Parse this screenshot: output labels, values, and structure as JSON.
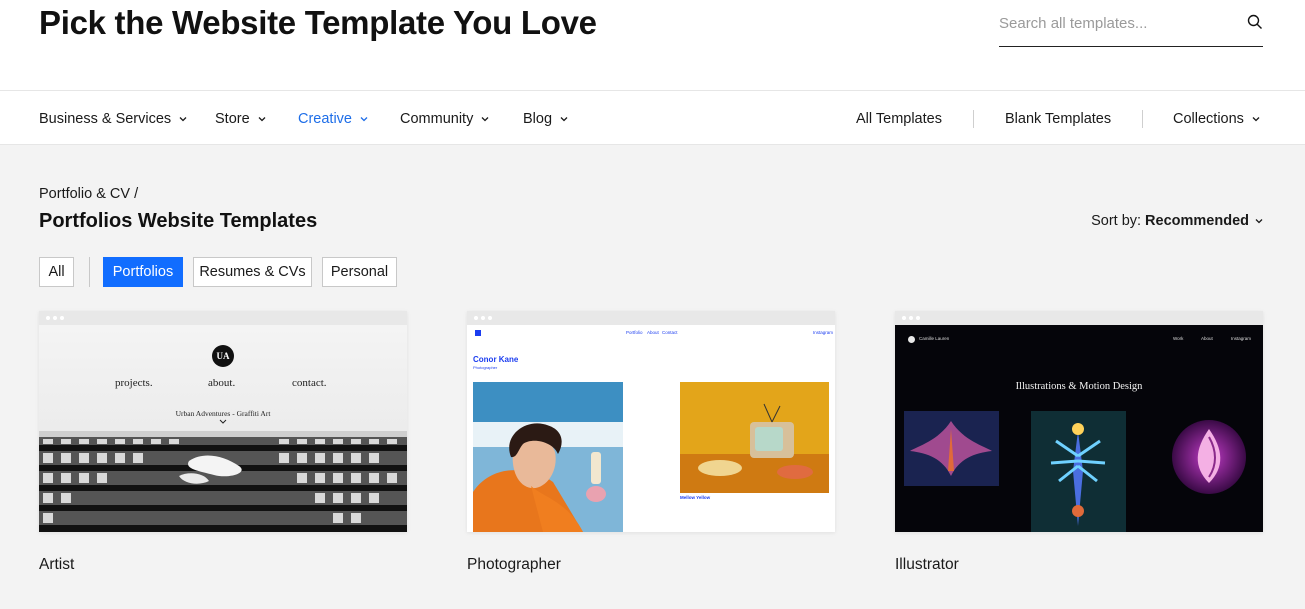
{
  "header": {
    "title": "Pick the Website Template You Love",
    "search_placeholder": "Search all templates..."
  },
  "nav": {
    "items": [
      {
        "label": "Business & Services",
        "active": false
      },
      {
        "label": "Store",
        "active": false
      },
      {
        "label": "Creative",
        "active": true
      },
      {
        "label": "Community",
        "active": false
      },
      {
        "label": "Blog",
        "active": false
      }
    ],
    "right": [
      {
        "label": "All Templates"
      },
      {
        "label": "Blank Templates"
      },
      {
        "label": "Collections"
      }
    ]
  },
  "breadcrumb": "Portfolio & CV /",
  "section_title": "Portfolios Website Templates",
  "sort": {
    "label": "Sort by:",
    "value": "Recommended"
  },
  "filters": [
    {
      "label": "All",
      "active": false
    },
    {
      "label": "Portfolios",
      "active": true
    },
    {
      "label": "Resumes & CVs",
      "active": false
    },
    {
      "label": "Personal",
      "active": false
    }
  ],
  "cards": [
    {
      "label": "Artist",
      "preview": {
        "logo": "UA",
        "menu": [
          "projects.",
          "about.",
          "contact."
        ],
        "tagline": "Urban Adventures - Graffiti Art"
      }
    },
    {
      "label": "Photographer",
      "preview": {
        "links": [
          "Portfolio",
          "About",
          "Contact"
        ],
        "social": "Instagram",
        "name": "Conor Kane",
        "role": "Photographer",
        "caption": "Mellow Yellow"
      }
    },
    {
      "label": "Illustrator",
      "preview": {
        "name": "Camille Lauren",
        "links": [
          "Work",
          "About",
          "Instagram"
        ],
        "headline": "Illustrations & Motion Design"
      }
    }
  ],
  "colors": {
    "accent": "#116dff",
    "nav_active": "#1e6ee8"
  }
}
